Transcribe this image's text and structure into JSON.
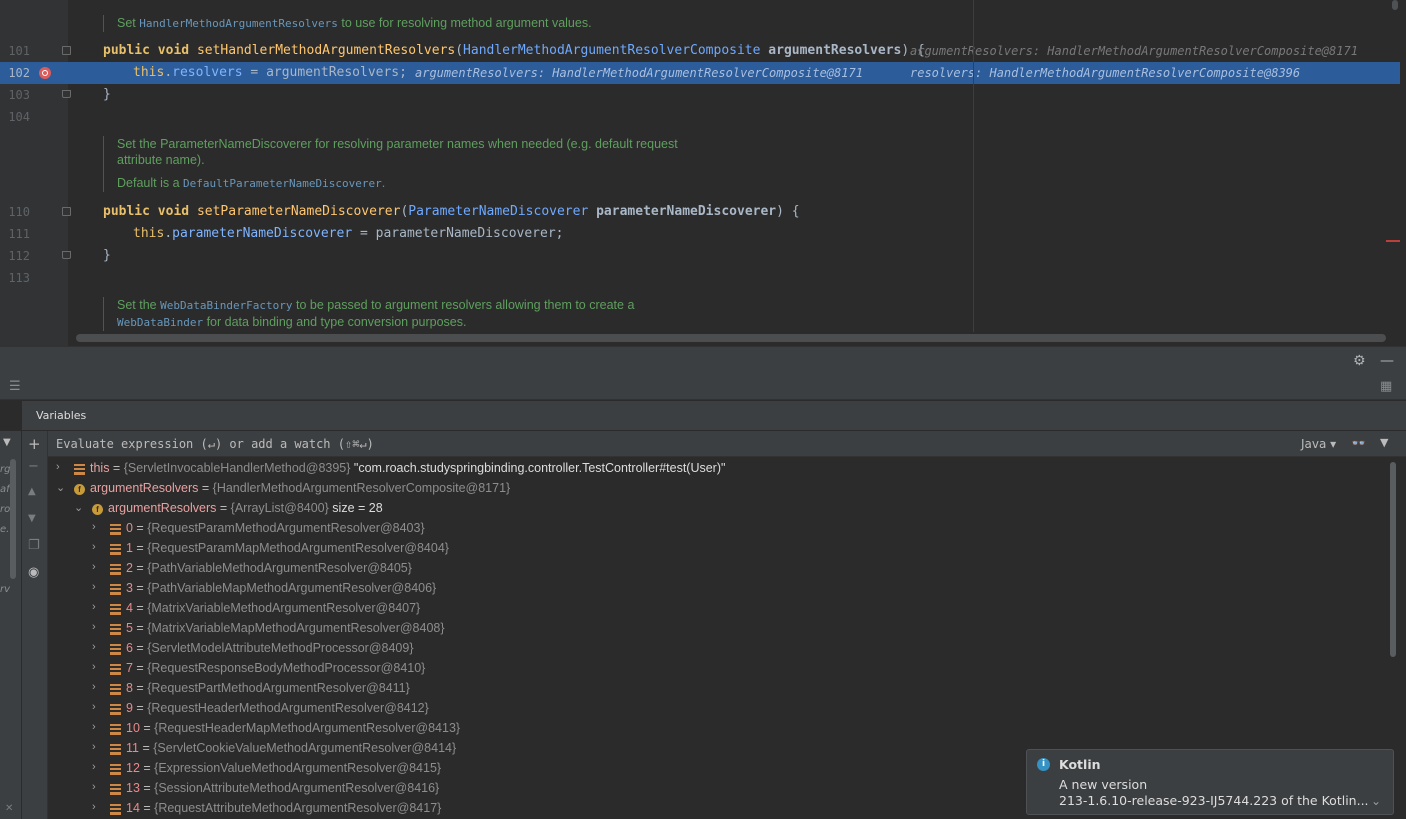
{
  "editor": {
    "docs": [
      {
        "lines": [
          [
            {
              "t": "Set "
            },
            {
              "t": "HandlerMethodArgumentResolvers",
              "mono": true
            },
            {
              "t": " to use for resolving method argument values."
            }
          ]
        ]
      },
      {
        "lines": [
          [
            {
              "t": "Set the ParameterNameDiscoverer for resolving parameter names when needed (e.g. default request"
            }
          ],
          [
            {
              "t": "attribute name)."
            }
          ],
          [
            {
              "t": "Default is a "
            },
            {
              "t": "DefaultParameterNameDiscoverer",
              "mono": true
            },
            {
              "t": "."
            }
          ]
        ]
      },
      {
        "lines": [
          [
            {
              "t": "Set the "
            },
            {
              "t": "WebDataBinderFactory",
              "mono": true
            },
            {
              "t": " to be passed to argument resolvers allowing them to create a"
            }
          ],
          [
            {
              "t": "WebDataBinder",
              "mono": true
            },
            {
              "t": " for data binding and type conversion purposes."
            }
          ]
        ]
      }
    ],
    "lines": {
      "l101": "101",
      "l102": "102",
      "l103": "103",
      "l104": "104",
      "l110": "110",
      "l111": "111",
      "l112": "112",
      "l113": "113"
    },
    "code": {
      "public": "public",
      "void": "void",
      "this": "this",
      "m1_name": "setHandlerMethodArgumentResolvers",
      "m1_type": "HandlerMethodArgumentResolverComposite",
      "m1_param": "argumentResolvers",
      "m1_hint": "argumentResolvers: HandlerMethodArgumentResolverComposite@8171",
      "l102_field": "resolvers",
      "l102_rhs": "argumentResolvers",
      "l102_hint1": "argumentResolvers: HandlerMethodArgumentResolverComposite@8171",
      "l102_hint2": "resolvers: HandlerMethodArgumentResolverComposite@8396",
      "close_brace": "}",
      "m2_name": "setParameterNameDiscoverer",
      "m2_type": "ParameterNameDiscoverer",
      "m2_param": "parameterNameDiscoverer",
      "l111_field": "parameterNameDiscoverer",
      "l111_rhs": "parameterNameDiscoverer"
    }
  },
  "debugger": {
    "variables_tab": "Variables",
    "eval_placeholder": "Evaluate expression (↵) or add a watch (⇧⌘↵)",
    "language": "Java",
    "left_fragments": [
      "rg",
      "af",
      "ro",
      "e.",
      "rv"
    ],
    "tree": [
      {
        "name": "this",
        "type": "{ServletInvocableHandlerMethod@8395}",
        "extra": " \"com.roach.studyspringbinding.controller.TestController#test(User)\"",
        "expanded": false,
        "depth": 0,
        "icon": "field"
      },
      {
        "name": "argumentResolvers",
        "type": "{HandlerMethodArgumentResolverComposite@8171}",
        "extra": "",
        "expanded": true,
        "depth": 0,
        "icon": "protected"
      },
      {
        "name": "argumentResolvers",
        "type": "{ArrayList@8400}",
        "extra": "  size = 28",
        "expanded": true,
        "depth": 1,
        "icon": "protected"
      },
      {
        "name": "0",
        "type": "{RequestParamMethodArgumentResolver@8403}",
        "extra": "",
        "expanded": false,
        "depth": 2,
        "icon": "field"
      },
      {
        "name": "1",
        "type": "{RequestParamMapMethodArgumentResolver@8404}",
        "extra": "",
        "expanded": false,
        "depth": 2,
        "icon": "field"
      },
      {
        "name": "2",
        "type": "{PathVariableMethodArgumentResolver@8405}",
        "extra": "",
        "expanded": false,
        "depth": 2,
        "icon": "field"
      },
      {
        "name": "3",
        "type": "{PathVariableMapMethodArgumentResolver@8406}",
        "extra": "",
        "expanded": false,
        "depth": 2,
        "icon": "field"
      },
      {
        "name": "4",
        "type": "{MatrixVariableMethodArgumentResolver@8407}",
        "extra": "",
        "expanded": false,
        "depth": 2,
        "icon": "field"
      },
      {
        "name": "5",
        "type": "{MatrixVariableMapMethodArgumentResolver@8408}",
        "extra": "",
        "expanded": false,
        "depth": 2,
        "icon": "field"
      },
      {
        "name": "6",
        "type": "{ServletModelAttributeMethodProcessor@8409}",
        "extra": "",
        "expanded": false,
        "depth": 2,
        "icon": "field"
      },
      {
        "name": "7",
        "type": "{RequestResponseBodyMethodProcessor@8410}",
        "extra": "",
        "expanded": false,
        "depth": 2,
        "icon": "field"
      },
      {
        "name": "8",
        "type": "{RequestPartMethodArgumentResolver@8411}",
        "extra": "",
        "expanded": false,
        "depth": 2,
        "icon": "field"
      },
      {
        "name": "9",
        "type": "{RequestHeaderMethodArgumentResolver@8412}",
        "extra": "",
        "expanded": false,
        "depth": 2,
        "icon": "field"
      },
      {
        "name": "10",
        "type": "{RequestHeaderMapMethodArgumentResolver@8413}",
        "extra": "",
        "expanded": false,
        "depth": 2,
        "icon": "field"
      },
      {
        "name": "11",
        "type": "{ServletCookieValueMethodArgumentResolver@8414}",
        "extra": "",
        "expanded": false,
        "depth": 2,
        "icon": "field"
      },
      {
        "name": "12",
        "type": "{ExpressionValueMethodArgumentResolver@8415}",
        "extra": "",
        "expanded": false,
        "depth": 2,
        "icon": "field"
      },
      {
        "name": "13",
        "type": "{SessionAttributeMethodArgumentResolver@8416}",
        "extra": "",
        "expanded": false,
        "depth": 2,
        "icon": "field"
      },
      {
        "name": "14",
        "type": "{RequestAttributeMethodArgumentResolver@8417}",
        "extra": "",
        "expanded": false,
        "depth": 2,
        "icon": "field"
      }
    ]
  },
  "notification": {
    "title": "Kotlin",
    "line1": "A new version",
    "line2": "213-1.6.10-release-923-IJ5744.223 of the Kotlin..."
  },
  "icons": {
    "settings": "gear-icon",
    "minimize": "minimize-icon",
    "add": "plus-icon",
    "remove": "minus-icon",
    "up": "arrow-up-icon",
    "down": "arrow-down-icon",
    "copy": "copy-icon",
    "watch": "eye-icon",
    "glasses": "glasses-icon",
    "layout": "layout-icon",
    "info": "info-icon"
  },
  "colors": {
    "editor_bg": "#2b2b2b",
    "highlight": "#2d5c9a",
    "keyword": "#cc7832",
    "method": "#ffc66d",
    "doc": "#5f9f5f",
    "breakpoint": "#db5c5c"
  }
}
